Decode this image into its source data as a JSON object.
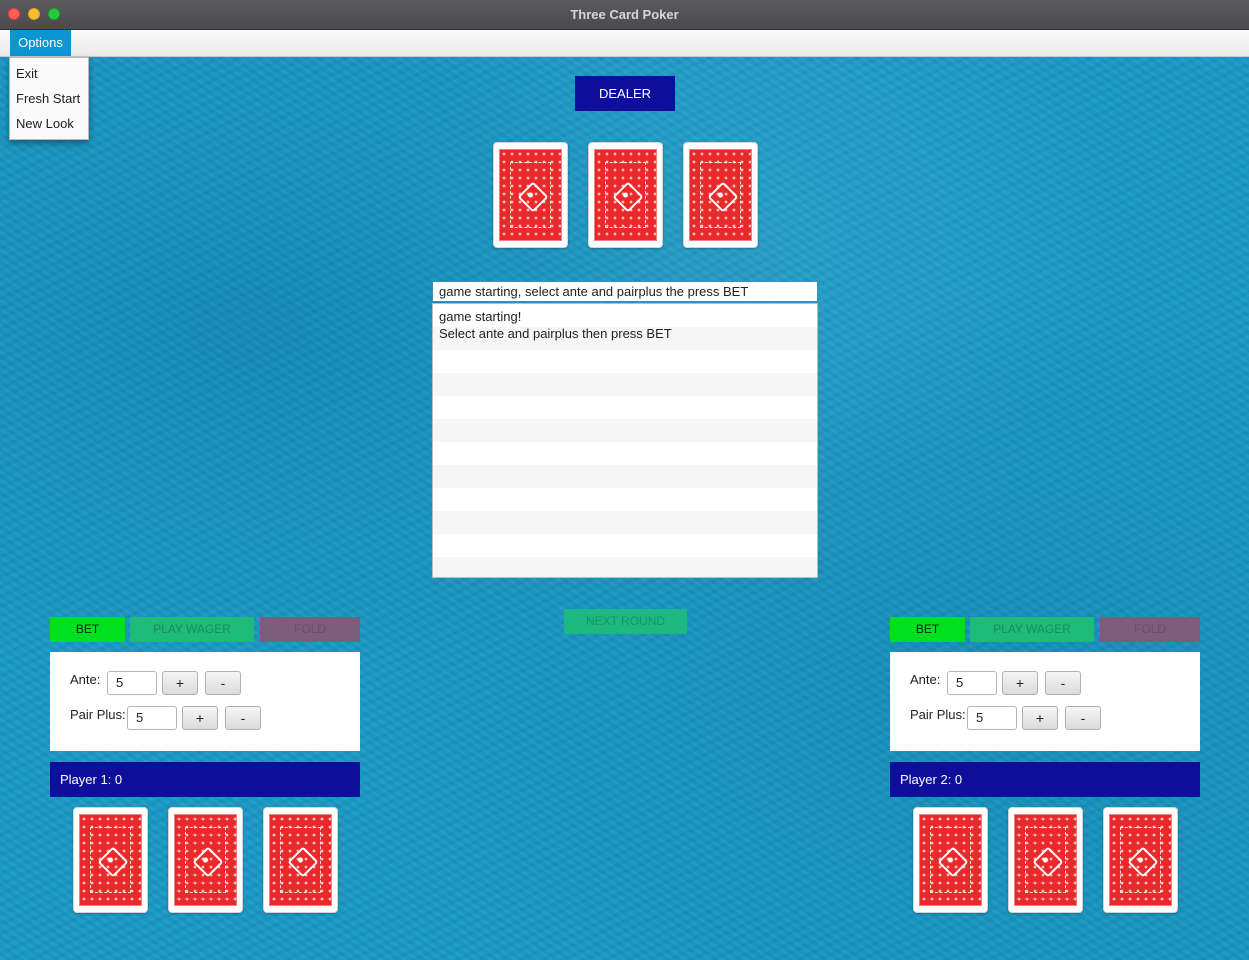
{
  "window": {
    "title": "Three Card Poker"
  },
  "menubar": {
    "options_label": "Options"
  },
  "options_menu": {
    "items": [
      "Exit",
      "Fresh Start",
      "New Look"
    ]
  },
  "dealer": {
    "label": "DEALER",
    "cards": [
      "card-back",
      "card-back",
      "card-back"
    ]
  },
  "log": {
    "current": "game starting, select ante and pairplus the press BET",
    "lines": [
      "game starting!",
      "Select ante and pairplus then press BET"
    ]
  },
  "center": {
    "next_round_label": "NEXT ROUND"
  },
  "player1": {
    "bet_label": "BET",
    "play_label": "PLAY WAGER",
    "fold_label": "FOLD",
    "ante_label": "Ante:",
    "ante_value": "5",
    "pairplus_label": "Pair Plus:",
    "pairplus_value": "5",
    "plus": "+",
    "minus": "-",
    "name_score": "Player 1: 0"
  },
  "player2": {
    "bet_label": "BET",
    "play_label": "PLAY WAGER",
    "fold_label": "FOLD",
    "ante_label": "Ante:",
    "ante_value": "5",
    "pairplus_label": "Pair Plus:",
    "pairplus_value": "5",
    "plus": "+",
    "minus": "-",
    "name_score": "Player 2: 0"
  },
  "colors": {
    "felt": "#1a9ac6",
    "label_bg": "#0d0f9a",
    "bet_button": "#00e020",
    "play_button": "#1dba7a",
    "fold_button": "#7c5e7c",
    "card_back": "#ea2a2a",
    "menu_highlight": "#0a96d3"
  }
}
